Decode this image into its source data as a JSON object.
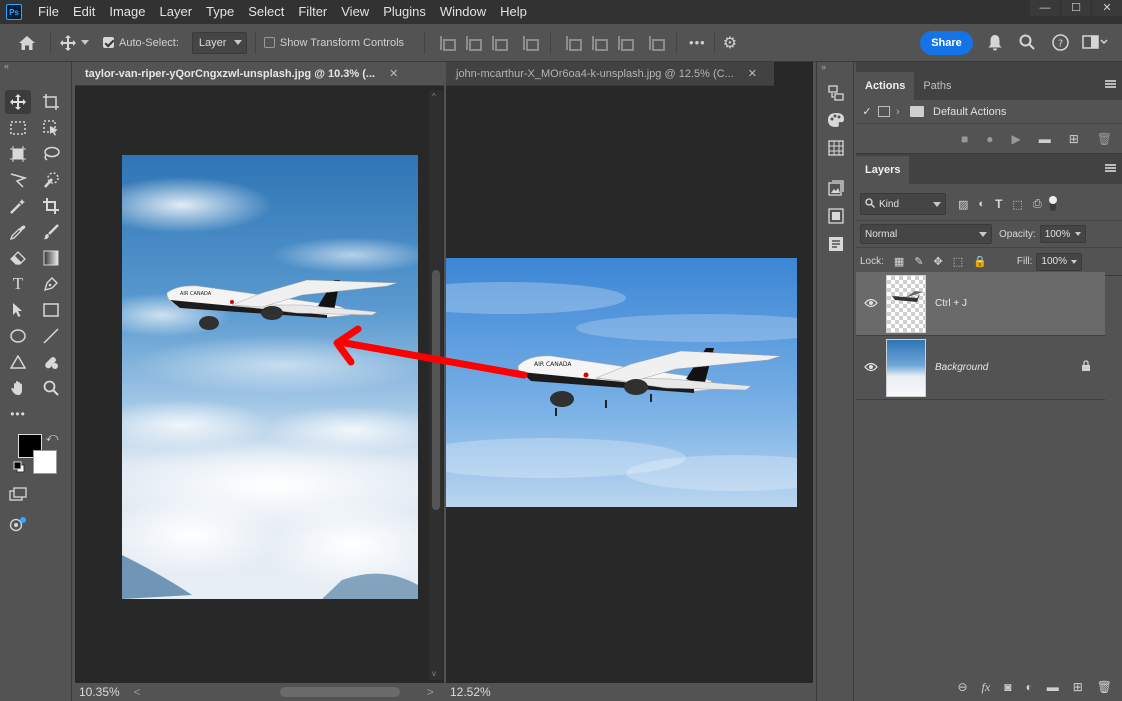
{
  "app": {
    "logo_text": "Ps"
  },
  "menu": [
    "File",
    "Edit",
    "Image",
    "Layer",
    "Type",
    "Select",
    "Filter",
    "View",
    "Plugins",
    "Window",
    "Help"
  ],
  "window_controls": {
    "minimize": "—",
    "maximize": "☐",
    "close": "✕"
  },
  "options_bar": {
    "auto_select_label": "Auto-Select:",
    "auto_select_checked": true,
    "auto_select_target": "Layer",
    "show_transform_label": "Show Transform Controls",
    "show_transform_checked": false,
    "more_label": "•••",
    "share_label": "Share"
  },
  "documents": [
    {
      "title": "taylor-van-riper-yQorCngxzwl-unsplash.jpg @ 10.3% (...",
      "close": "✕",
      "zoom_status": "10.35%",
      "active": true
    },
    {
      "title": "john-mcarthur-X_MOr6oa4-k-unsplash.jpg @ 12.5% (C...",
      "close": "✕",
      "zoom_status": "12.52%",
      "active": false
    }
  ],
  "panels": {
    "actions_tab": "Actions",
    "paths_tab": "Paths",
    "actions_set": "Default Actions",
    "layers_tab": "Layers",
    "kind_label": "Kind",
    "blend_mode": "Normal",
    "opacity_label": "Opacity:",
    "opacity_value": "100%",
    "lock_label": "Lock:",
    "fill_label": "Fill:",
    "fill_value": "100%",
    "layers": [
      {
        "name": "Ctrl + J",
        "selected": true,
        "locked": false
      },
      {
        "name": "Background",
        "selected": false,
        "locked": true
      }
    ]
  },
  "colors": {
    "accent_blue": "#1473e6",
    "arrow_red": "#ff0000",
    "chrome_dark": "#323232",
    "panel_gray": "#535353",
    "canvas_bg": "#282828"
  }
}
